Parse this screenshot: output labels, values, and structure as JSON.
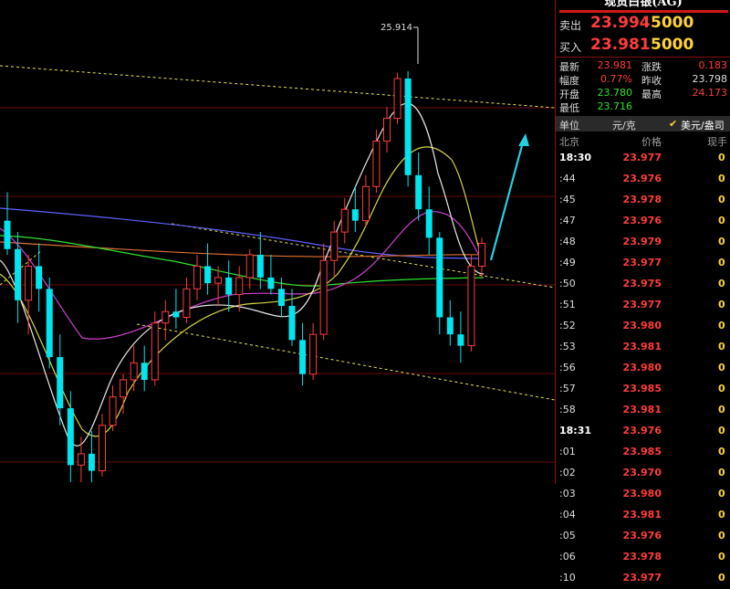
{
  "panel": {
    "title": "现货白银(AG)",
    "sell": {
      "label": "卖出",
      "price": "23.994",
      "volume": "5000"
    },
    "buy": {
      "label": "买入",
      "price": "23.981",
      "volume": "5000"
    },
    "stats": [
      {
        "label": "最新",
        "value": "23.981",
        "color": "#ff3c3c"
      },
      {
        "label": "涨跌",
        "value": "0.183",
        "color": "#ff3c3c"
      },
      {
        "label": "幅度",
        "value": "0.77%",
        "color": "#ff3c3c"
      },
      {
        "label": "昨收",
        "value": "23.798",
        "color": "#dcdcdc"
      },
      {
        "label": "开盘",
        "value": "23.780",
        "color": "#2ee02e"
      },
      {
        "label": "最高",
        "value": "24.173",
        "color": "#ff3c3c"
      },
      {
        "label": "最低",
        "value": "23.716",
        "color": "#2ee02e"
      }
    ],
    "unit": {
      "label": "单位",
      "yuan": "元/克",
      "usd": "美元/盎司"
    },
    "columns": {
      "time": "北京",
      "price": "价格",
      "vol": "现手"
    },
    "ticks": [
      {
        "time": "18:30",
        "price": "23.977",
        "vol": "0"
      },
      {
        "time": ":44",
        "price": "23.976",
        "vol": "0"
      },
      {
        "time": ":45",
        "price": "23.978",
        "vol": "0"
      },
      {
        "time": ":47",
        "price": "23.976",
        "vol": "0"
      },
      {
        "time": ":48",
        "price": "23.979",
        "vol": "0"
      },
      {
        "time": ":49",
        "price": "23.977",
        "vol": "0"
      },
      {
        "time": ":50",
        "price": "23.975",
        "vol": "0"
      },
      {
        "time": ":51",
        "price": "23.977",
        "vol": "0"
      },
      {
        "time": ":52",
        "price": "23.980",
        "vol": "0"
      },
      {
        "time": ":53",
        "price": "23.981",
        "vol": "0"
      },
      {
        "time": ":56",
        "price": "23.980",
        "vol": "0"
      },
      {
        "time": ":57",
        "price": "23.985",
        "vol": "0"
      },
      {
        "time": ":58",
        "price": "23.981",
        "vol": "0"
      },
      {
        "time": "18:31",
        "price": "23.976",
        "vol": "0"
      },
      {
        "time": ":01",
        "price": "23.985",
        "vol": "0"
      },
      {
        "time": ":02",
        "price": "23.970",
        "vol": "0"
      },
      {
        "time": ":03",
        "price": "23.980",
        "vol": "0"
      },
      {
        "time": ":04",
        "price": "23.981",
        "vol": "0"
      },
      {
        "time": ":05",
        "price": "23.976",
        "vol": "0"
      },
      {
        "time": ":06",
        "price": "23.978",
        "vol": "0"
      },
      {
        "time": ":10",
        "price": "23.977",
        "vol": "0"
      }
    ]
  },
  "chart_data": {
    "type": "candlestick",
    "title": "",
    "high_label": "25.914",
    "ylim": [
      22.3,
      26.3
    ],
    "colors": {
      "up": "#ff3c3c",
      "down": "#00e5ee",
      "ma5": "#e8e8e8",
      "ma10": "#d6d646",
      "ma20": "#d040d0",
      "ma60": "#2ee02e",
      "ma120": "#e07030",
      "ma250": "#6060ff",
      "trend": "#e6e64a",
      "arrow": "#26d0e0"
    },
    "candles": [
      {
        "o": 24.6,
        "h": 24.85,
        "l": 24.3,
        "c": 24.35
      },
      {
        "o": 24.35,
        "h": 24.5,
        "l": 23.7,
        "c": 23.9
      },
      {
        "o": 23.9,
        "h": 24.3,
        "l": 23.6,
        "c": 24.2
      },
      {
        "o": 24.2,
        "h": 24.4,
        "l": 23.8,
        "c": 24.0
      },
      {
        "o": 24.0,
        "h": 24.1,
        "l": 23.3,
        "c": 23.4
      },
      {
        "o": 23.4,
        "h": 23.6,
        "l": 22.8,
        "c": 22.95
      },
      {
        "o": 22.95,
        "h": 23.1,
        "l": 22.3,
        "c": 22.45
      },
      {
        "o": 22.45,
        "h": 22.7,
        "l": 22.3,
        "c": 22.55
      },
      {
        "o": 22.55,
        "h": 22.75,
        "l": 22.3,
        "c": 22.4
      },
      {
        "o": 22.4,
        "h": 22.9,
        "l": 22.35,
        "c": 22.8
      },
      {
        "o": 22.8,
        "h": 23.15,
        "l": 22.75,
        "c": 23.05
      },
      {
        "o": 23.05,
        "h": 23.25,
        "l": 22.9,
        "c": 23.2
      },
      {
        "o": 23.2,
        "h": 23.5,
        "l": 23.1,
        "c": 23.35
      },
      {
        "o": 23.35,
        "h": 23.5,
        "l": 23.1,
        "c": 23.2
      },
      {
        "o": 23.2,
        "h": 23.8,
        "l": 23.15,
        "c": 23.7
      },
      {
        "o": 23.7,
        "h": 23.9,
        "l": 23.55,
        "c": 23.8
      },
      {
        "o": 23.8,
        "h": 24.0,
        "l": 23.65,
        "c": 23.75
      },
      {
        "o": 23.75,
        "h": 24.1,
        "l": 23.7,
        "c": 24.0
      },
      {
        "o": 24.0,
        "h": 24.3,
        "l": 23.9,
        "c": 24.2
      },
      {
        "o": 24.2,
        "h": 24.4,
        "l": 23.95,
        "c": 24.05
      },
      {
        "o": 24.05,
        "h": 24.2,
        "l": 23.85,
        "c": 24.1
      },
      {
        "o": 24.1,
        "h": 24.25,
        "l": 23.8,
        "c": 23.95
      },
      {
        "o": 23.95,
        "h": 24.2,
        "l": 23.8,
        "c": 24.1
      },
      {
        "o": 24.1,
        "h": 24.35,
        "l": 24.0,
        "c": 24.3
      },
      {
        "o": 24.3,
        "h": 24.5,
        "l": 24.0,
        "c": 24.1
      },
      {
        "o": 24.1,
        "h": 24.3,
        "l": 23.95,
        "c": 24.0
      },
      {
        "o": 24.0,
        "h": 24.1,
        "l": 23.75,
        "c": 23.85
      },
      {
        "o": 23.85,
        "h": 24.0,
        "l": 23.5,
        "c": 23.55
      },
      {
        "o": 23.55,
        "h": 23.7,
        "l": 23.15,
        "c": 23.25
      },
      {
        "o": 23.25,
        "h": 23.7,
        "l": 23.2,
        "c": 23.6
      },
      {
        "o": 23.6,
        "h": 24.4,
        "l": 23.55,
        "c": 24.25
      },
      {
        "o": 24.25,
        "h": 24.6,
        "l": 24.1,
        "c": 24.5
      },
      {
        "o": 24.5,
        "h": 24.8,
        "l": 24.4,
        "c": 24.7
      },
      {
        "o": 24.7,
        "h": 24.9,
        "l": 24.5,
        "c": 24.6
      },
      {
        "o": 24.6,
        "h": 25.0,
        "l": 24.55,
        "c": 24.9
      },
      {
        "o": 24.9,
        "h": 25.4,
        "l": 24.85,
        "c": 25.3
      },
      {
        "o": 25.3,
        "h": 25.6,
        "l": 25.2,
        "c": 25.5
      },
      {
        "o": 25.5,
        "h": 25.9,
        "l": 25.45,
        "c": 25.85
      },
      {
        "o": 25.85,
        "h": 25.914,
        "l": 24.9,
        "c": 25.0
      },
      {
        "o": 25.0,
        "h": 25.2,
        "l": 24.6,
        "c": 24.7
      },
      {
        "o": 24.7,
        "h": 24.9,
        "l": 24.3,
        "c": 24.45
      },
      {
        "o": 24.45,
        "h": 24.5,
        "l": 23.6,
        "c": 23.75
      },
      {
        "o": 23.75,
        "h": 23.9,
        "l": 23.5,
        "c": 23.6
      },
      {
        "o": 23.6,
        "h": 23.8,
        "l": 23.35,
        "c": 23.5
      },
      {
        "o": 23.5,
        "h": 24.3,
        "l": 23.45,
        "c": 24.2
      },
      {
        "o": 24.2,
        "h": 24.45,
        "l": 24.1,
        "c": 24.4
      }
    ]
  }
}
